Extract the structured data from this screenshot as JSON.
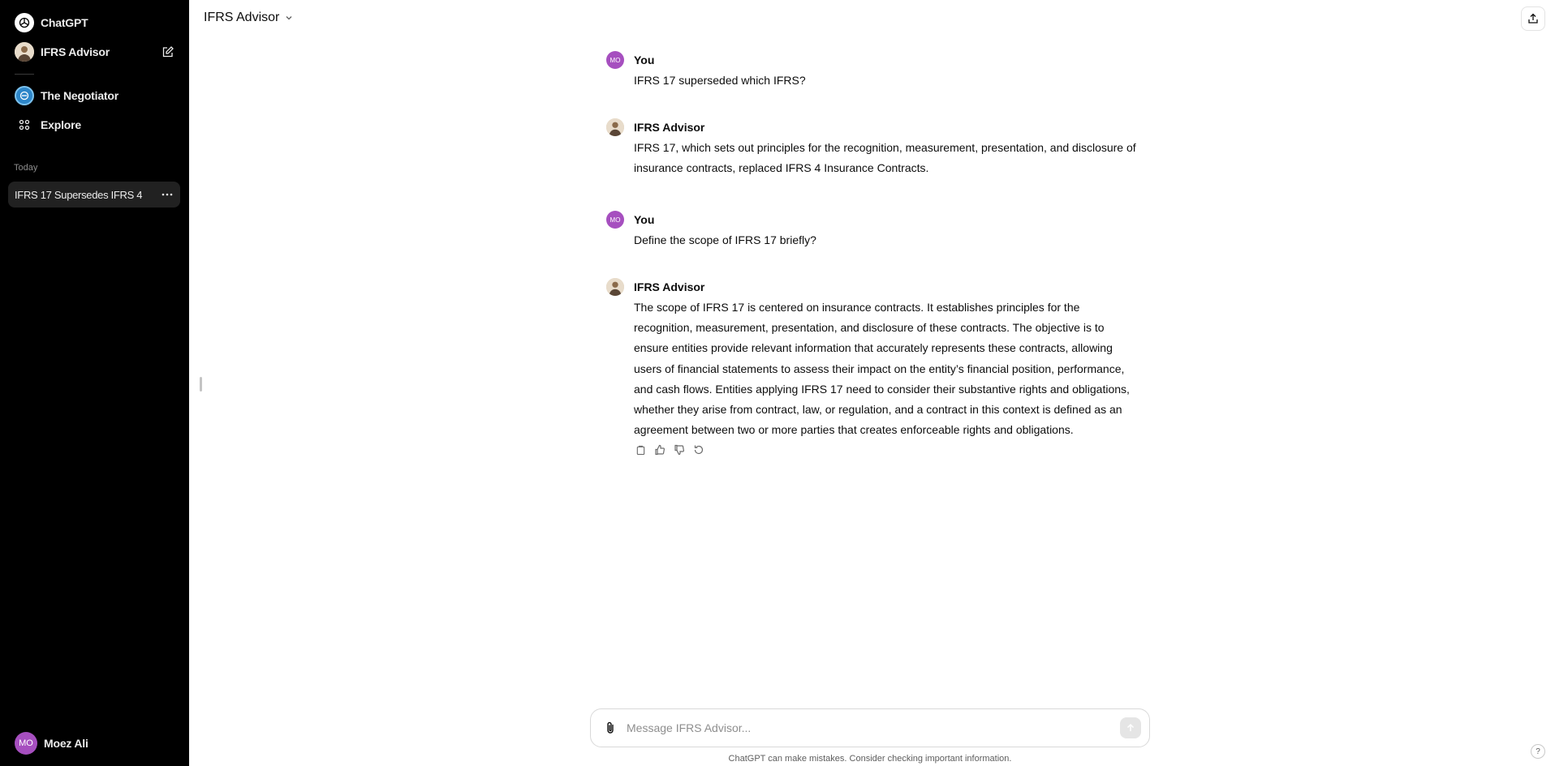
{
  "sidebar": {
    "app_name": "ChatGPT",
    "gpts": [
      {
        "label": "IFRS Advisor"
      },
      {
        "label": "The Negotiator"
      }
    ],
    "explore_label": "Explore",
    "section_label": "Today",
    "chats": [
      {
        "label": "IFRS 17 Supersedes IFRS 4"
      }
    ],
    "user": {
      "initials": "MO",
      "name": "Moez Ali"
    }
  },
  "header": {
    "title": "IFRS Advisor"
  },
  "messages": [
    {
      "author": "You",
      "initials": "MO",
      "role": "user",
      "text": "IFRS 17 superseded which IFRS?"
    },
    {
      "author": "IFRS Advisor",
      "role": "assistant",
      "text": "IFRS 17, which sets out principles for the recognition, measurement, presentation, and disclosure of insurance contracts, replaced IFRS 4 Insurance Contracts."
    },
    {
      "author": "You",
      "initials": "MO",
      "role": "user",
      "text": "Define the scope of IFRS 17 briefly?"
    },
    {
      "author": "IFRS Advisor",
      "role": "assistant",
      "text": "The scope of IFRS 17 is centered on insurance contracts. It establishes principles for the recognition, measurement, presentation, and disclosure of these contracts. The objective is to ensure entities provide relevant information that accurately represents these contracts, allowing users of financial statements to assess their impact on the entity’s financial position, performance, and cash flows. Entities applying IFRS 17 need to consider their substantive rights and obligations, whether they arise from contract, law, or regulation, and a contract in this context is defined as an agreement between two or more parties that creates enforceable rights and obligations."
    }
  ],
  "composer": {
    "placeholder": "Message IFRS Advisor..."
  },
  "disclaimer": "ChatGPT can make mistakes. Consider checking important information.",
  "help_label": "?",
  "icons": {
    "attach": "paperclip-icon",
    "send": "arrow-up-icon",
    "share": "share-icon",
    "copy": "copy-icon",
    "like": "thumbs-up-icon",
    "dislike": "thumbs-down-icon",
    "regenerate": "regenerate-icon"
  }
}
